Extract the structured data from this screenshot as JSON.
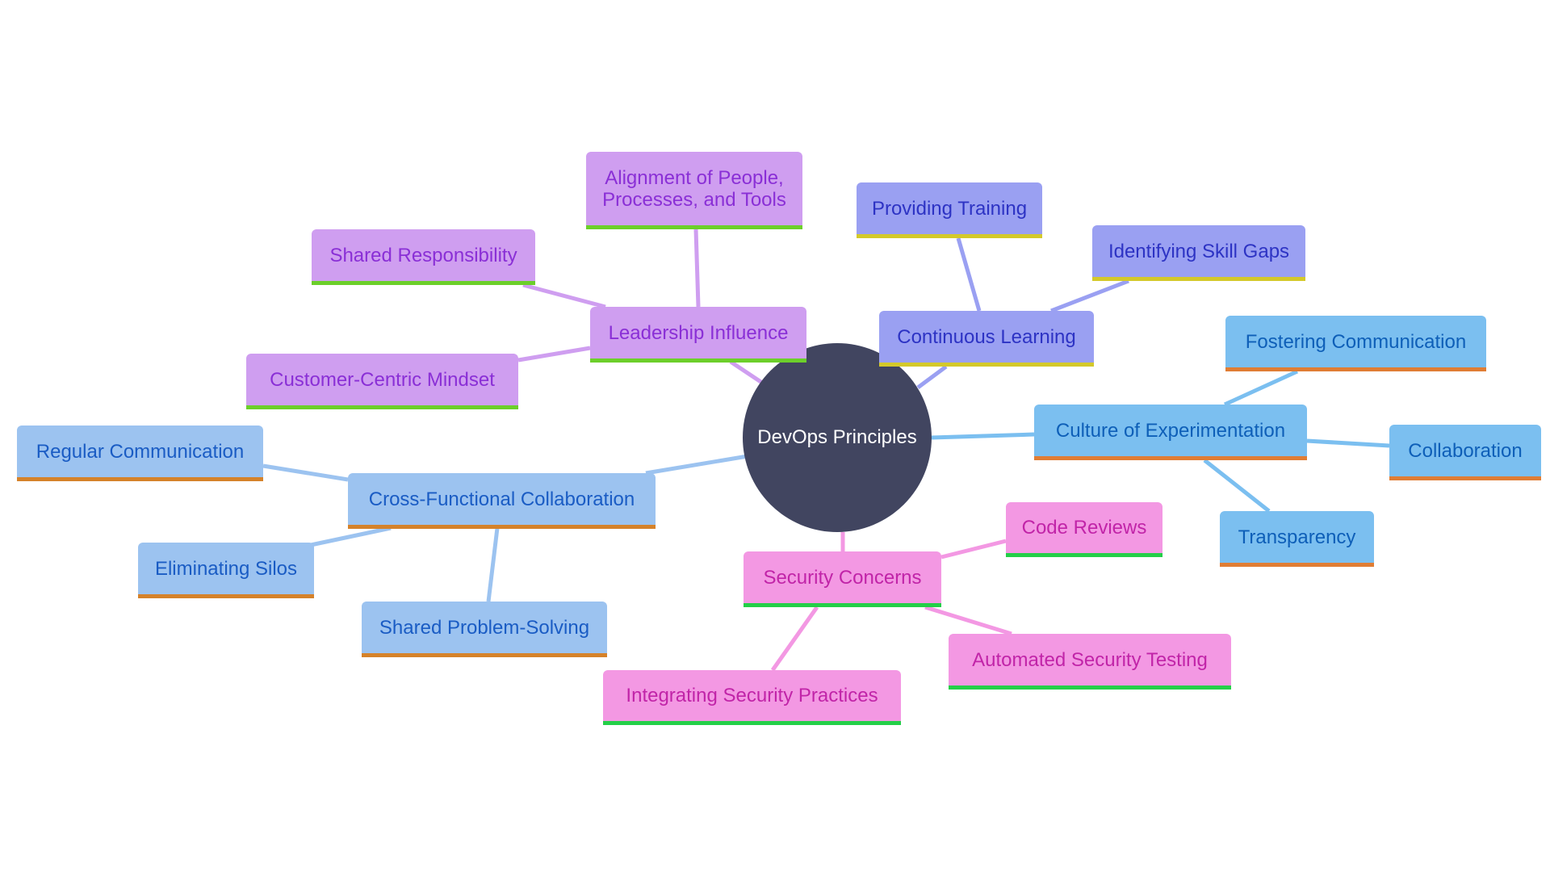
{
  "root": {
    "label": "DevOps Principles",
    "color": "#414560"
  },
  "branches": [
    {
      "id": "leadership",
      "label": "Leadership Influence",
      "theme": "purple",
      "colors": {
        "fill": "#cf9ef0",
        "text": "#8a2fd6",
        "underline": "#6ccf2a",
        "edge": "#cf9ef0"
      },
      "children": [
        {
          "label": "Alignment of People, Processes, and Tools"
        },
        {
          "label": "Shared Responsibility"
        },
        {
          "label": "Customer-Centric Mindset"
        }
      ]
    },
    {
      "id": "learning",
      "label": "Continuous Learning",
      "theme": "indigo",
      "colors": {
        "fill": "#9aa0f2",
        "text": "#2d33c4",
        "underline": "#d4c92a",
        "edge": "#9aa0f2"
      },
      "children": [
        {
          "label": "Providing Training"
        },
        {
          "label": "Identifying Skill Gaps"
        }
      ]
    },
    {
      "id": "experimentation",
      "label": "Culture of Experimentation",
      "theme": "sky",
      "colors": {
        "fill": "#7bbff0",
        "text": "#0e5fb8",
        "underline": "#e07d34",
        "edge": "#7bbff0"
      },
      "children": [
        {
          "label": "Fostering Communication"
        },
        {
          "label": "Collaboration"
        },
        {
          "label": "Transparency"
        }
      ]
    },
    {
      "id": "collaboration",
      "label": "Cross-Functional Collaboration",
      "theme": "blue",
      "colors": {
        "fill": "#9cc3f0",
        "text": "#1a5cc4",
        "underline": "#d5822a",
        "edge": "#9cc3f0"
      },
      "children": [
        {
          "label": "Regular Communication"
        },
        {
          "label": "Eliminating Silos"
        },
        {
          "label": "Shared Problem-Solving"
        }
      ]
    },
    {
      "id": "security",
      "label": "Security Concerns",
      "theme": "pink",
      "colors": {
        "fill": "#f398e3",
        "text": "#c124a8",
        "underline": "#24cf48",
        "edge": "#f398e3"
      },
      "children": [
        {
          "label": "Code Reviews"
        },
        {
          "label": "Automated Security Testing"
        },
        {
          "label": "Integrating Security Practices"
        }
      ]
    }
  ]
}
